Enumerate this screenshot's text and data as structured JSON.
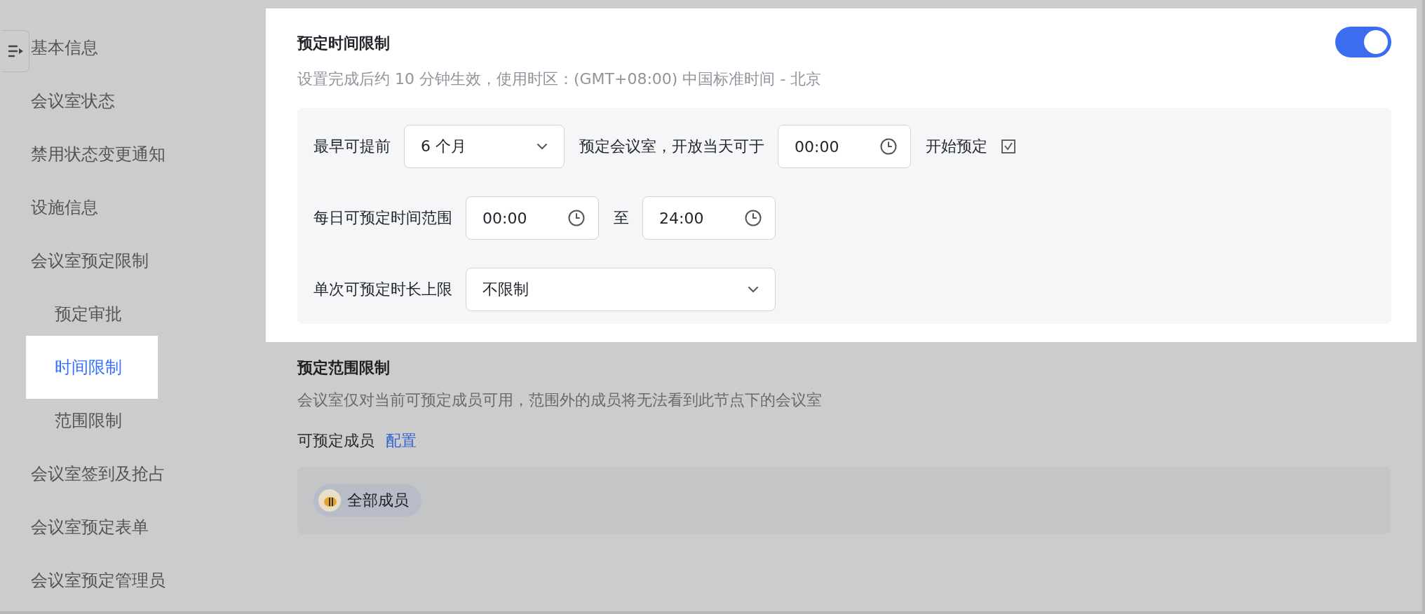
{
  "sidebar": {
    "items": [
      {
        "label": "基本信息",
        "selected": false
      },
      {
        "label": "会议室状态",
        "selected": false
      },
      {
        "label": "禁用状态变更通知",
        "selected": false
      },
      {
        "label": "设施信息",
        "selected": false
      },
      {
        "label": "会议室预定限制",
        "selected": false,
        "children": [
          {
            "label": "预定审批",
            "selected": false
          },
          {
            "label": "时间限制",
            "selected": true
          },
          {
            "label": "范围限制",
            "selected": false
          }
        ]
      },
      {
        "label": "会议室签到及抢占",
        "selected": false
      },
      {
        "label": "会议室预定表单",
        "selected": false
      },
      {
        "label": "会议室预定管理员",
        "selected": false
      }
    ]
  },
  "time_limit": {
    "title": "预定时间限制",
    "enabled": true,
    "description": "设置完成后约 10 分钟生效，使用时区：(GMT+08:00) 中国标准时间 - 北京",
    "lines": [
      {
        "parts": [
          {
            "kind": "text",
            "text": "最早可提前"
          },
          {
            "kind": "select",
            "value": "6 个月"
          },
          {
            "kind": "text",
            "text": "预定会议室，开放当天可于"
          },
          {
            "kind": "time",
            "value": "00:00"
          },
          {
            "kind": "text",
            "text": "开始预定"
          },
          {
            "kind": "icon"
          }
        ]
      },
      {
        "parts": [
          {
            "kind": "text",
            "text": "每日可预定时间范围"
          },
          {
            "kind": "time",
            "value": "00:00"
          },
          {
            "kind": "text",
            "text": "至"
          },
          {
            "kind": "time",
            "value": "24:00"
          }
        ]
      },
      {
        "parts": [
          {
            "kind": "text",
            "text": "单次可预定时长上限"
          },
          {
            "kind": "wide_select",
            "value": "不限制"
          }
        ]
      }
    ]
  },
  "scope_limit": {
    "title": "预定范围限制",
    "description": "会议室仅对当前可预定成员可用，范围外的成员将无法看到此节点下的会议室",
    "members_label": "可预定成员",
    "configure_link": "配置",
    "members": [
      {
        "name": "全部成员"
      }
    ]
  }
}
